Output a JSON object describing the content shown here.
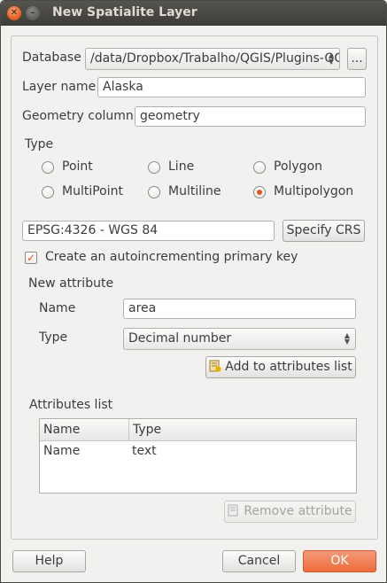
{
  "window": {
    "title": "New Spatialite Layer"
  },
  "database": {
    "label": "Database",
    "value": "/data/Dropbox/Trabalho/QGIS/Plugins-QGIS/Spatialite/database.sqlite",
    "browse_label": "..."
  },
  "layer_name": {
    "label": "Layer name",
    "value": "Alaska"
  },
  "geometry_column": {
    "label": "Geometry column",
    "value": "geometry"
  },
  "type_group": {
    "label": "Type",
    "options": [
      {
        "label": "Point",
        "selected": false
      },
      {
        "label": "Line",
        "selected": false
      },
      {
        "label": "Polygon",
        "selected": false
      },
      {
        "label": "MultiPoint",
        "selected": false
      },
      {
        "label": "Multiline",
        "selected": false
      },
      {
        "label": "Multipolygon",
        "selected": true
      }
    ]
  },
  "crs": {
    "value": "EPSG:4326 - WGS 84",
    "button_label": "Specify CRS"
  },
  "primary_key": {
    "label": "Create an autoincrementing primary key",
    "checked": true
  },
  "new_attribute": {
    "label": "New attribute",
    "name_label": "Name",
    "name_value": "area",
    "type_label": "Type",
    "type_value": "Decimal number",
    "add_button": "Add to attributes list"
  },
  "attributes_list": {
    "label": "Attributes list",
    "columns": [
      "Name",
      "Type"
    ],
    "rows": [
      {
        "name": "Name",
        "type": "text"
      }
    ],
    "remove_button": "Remove attribute"
  },
  "footer": {
    "help": "Help",
    "cancel": "Cancel",
    "ok": "OK"
  },
  "colors": {
    "accent": "#e0571c",
    "ok_button": "#ee6b3c",
    "titlebar": "#3d3c38"
  }
}
